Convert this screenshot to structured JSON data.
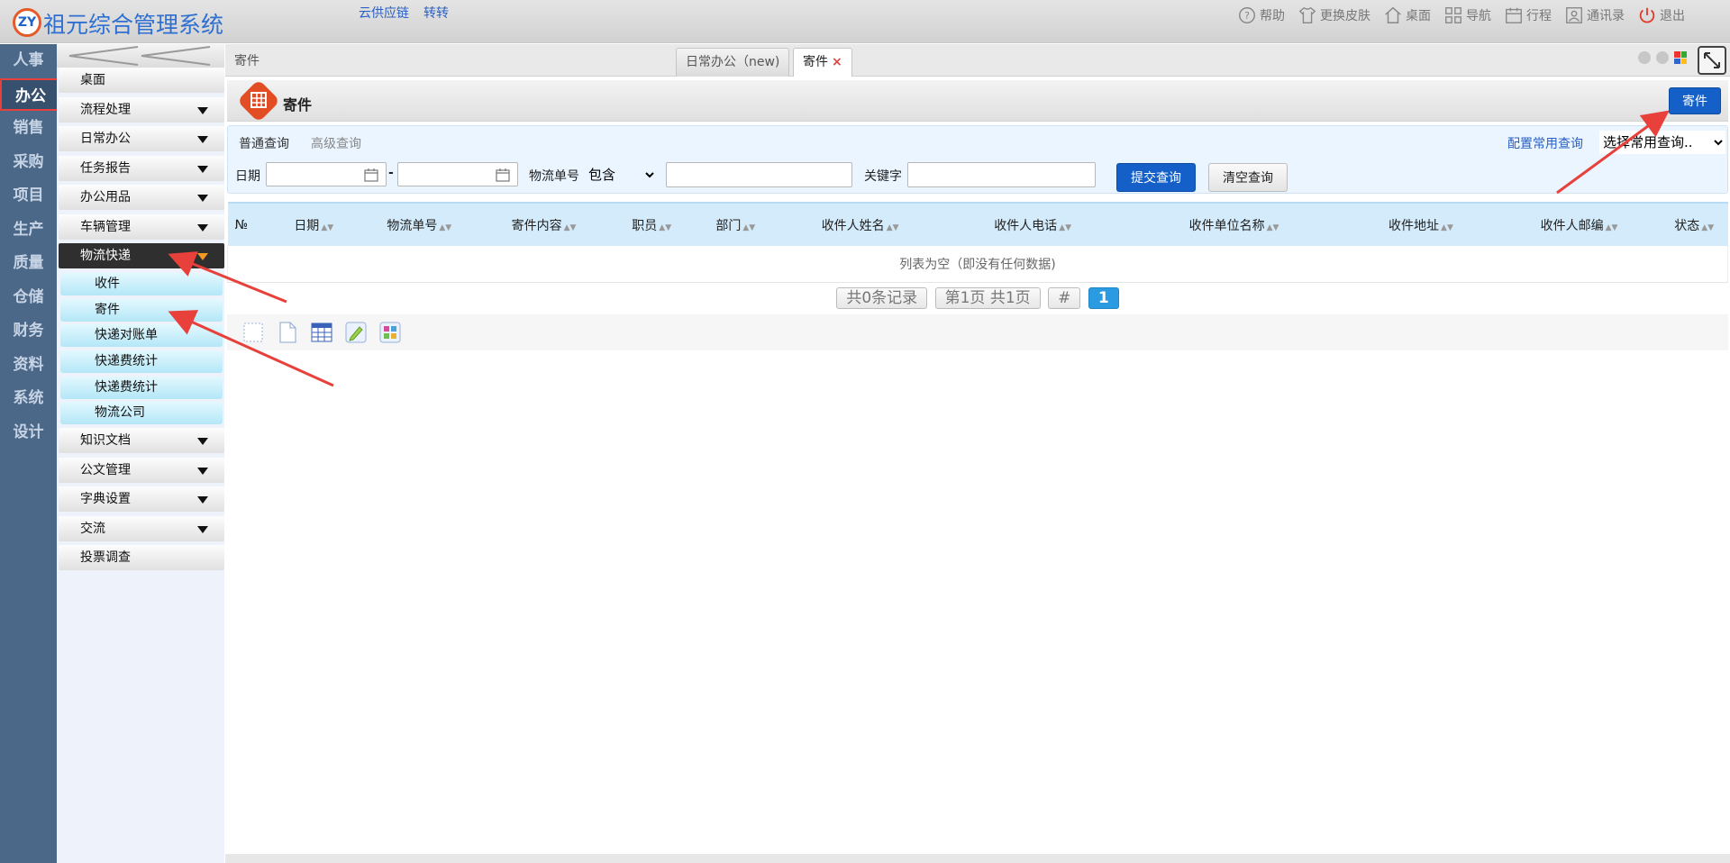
{
  "app": {
    "title": "祖元综合管理系统",
    "logo_text": "ZY",
    "top_links": [
      "云供应链",
      "转转"
    ],
    "top_actions": [
      {
        "label": "帮助",
        "icon": "help-icon"
      },
      {
        "label": "更换皮肤",
        "icon": "shirt-icon"
      },
      {
        "label": "桌面",
        "icon": "home-icon"
      },
      {
        "label": "导航",
        "icon": "grid-icon"
      },
      {
        "label": "行程",
        "icon": "calendar-icon"
      },
      {
        "label": "通讯录",
        "icon": "contacts-icon"
      },
      {
        "label": "退出",
        "icon": "power-icon"
      }
    ]
  },
  "modules": [
    "人事",
    "办公",
    "销售",
    "采购",
    "项目",
    "生产",
    "质量",
    "仓储",
    "财务",
    "资料",
    "系统",
    "设计"
  ],
  "active_module": "办公",
  "menu": {
    "items": [
      {
        "label": "桌面",
        "has_arrow": false
      },
      {
        "label": "流程处理",
        "has_arrow": true
      },
      {
        "label": "日常办公",
        "has_arrow": true
      },
      {
        "label": "任务报告",
        "has_arrow": true
      },
      {
        "label": "办公用品",
        "has_arrow": true
      },
      {
        "label": "车辆管理",
        "has_arrow": true
      },
      {
        "label": "物流快递",
        "has_arrow": true,
        "active": true
      },
      {
        "label": "知识文档",
        "has_arrow": true
      },
      {
        "label": "公文管理",
        "has_arrow": true
      },
      {
        "label": "字典设置",
        "has_arrow": true
      },
      {
        "label": "交流",
        "has_arrow": true
      },
      {
        "label": "投票调查",
        "has_arrow": false
      }
    ],
    "sub_items": [
      "收件",
      "寄件",
      "快递对账单",
      "快递费统计",
      "快递费统计",
      "物流公司"
    ]
  },
  "tabs": {
    "breadcrumb": "寄件",
    "items": [
      {
        "label": "日常办公（new)"
      },
      {
        "label": "寄件",
        "close": "×"
      }
    ]
  },
  "panel": {
    "title": "寄件",
    "action_button": "寄件"
  },
  "search": {
    "normal_tab": "普通查询",
    "advanced_tab": "高级查询",
    "config_link": "配置常用查询",
    "saved_query_placeholder": "选择常用查询..",
    "date_label": "日期",
    "date_sep": "-",
    "tracking_label": "物流单号",
    "match_mode": "包含",
    "keyword_label": "关键字",
    "submit": "提交查询",
    "clear": "清空查询"
  },
  "table": {
    "columns": [
      "№",
      "日期",
      "物流单号",
      "寄件内容",
      "职员",
      "部门",
      "收件人姓名",
      "收件人电话",
      "收件单位名称",
      "收件地址",
      "收件人邮编",
      "状态"
    ],
    "empty_text": "列表为空（即没有任何数据)"
  },
  "pager": {
    "total": "共0条记录",
    "page_info": "第1页 共1页",
    "jump": "#",
    "current_page": "1"
  },
  "colors": {
    "accent": "#1560c8",
    "module_nav_bg": "#4b6889",
    "title_blue": "#2f6fd1",
    "annotation_red": "#e8403a"
  }
}
